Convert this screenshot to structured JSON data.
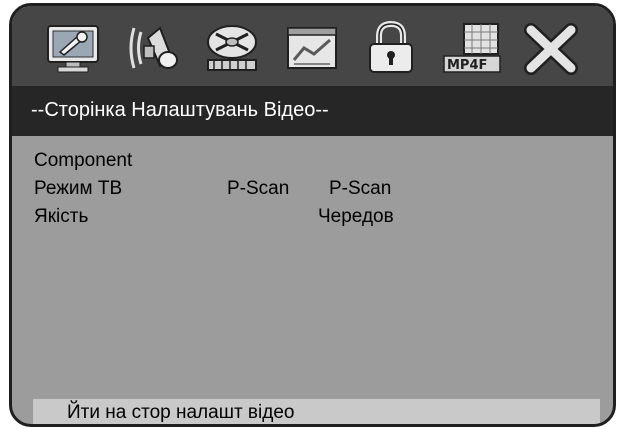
{
  "menu": {
    "icons": [
      {
        "name": "system-setup-icon",
        "label": "System Setup"
      },
      {
        "name": "audio-setup-icon",
        "label": "Audio Setup"
      },
      {
        "name": "video-setup-icon",
        "label": "Video Setup"
      },
      {
        "name": "preference-setup-icon",
        "label": "Preference Setup"
      },
      {
        "name": "password-setup-icon",
        "label": "Password Setup"
      },
      {
        "name": "mpeg4-setup-icon",
        "label": "MPEG4 Setup"
      },
      {
        "name": "exit-setup-icon",
        "label": "Exit Setup"
      }
    ],
    "active_icon": "video-setup-icon"
  },
  "page": {
    "title": "--Сторінка Налаштувань Відео--"
  },
  "settings": {
    "component_label": "Component",
    "tv_mode_label": "Режим ТВ",
    "tv_mode_value": "P-Scan",
    "tv_mode_option": "P-Scan",
    "quality_label": "Якість",
    "quality_value": "Чередов"
  },
  "footer": {
    "hint": "Йти на стор налашт відео"
  },
  "colors": {
    "panel": "#9c9c9c",
    "icon_bar": "#464646",
    "title_bar": "#262626",
    "hint_bar": "#c9c9c9",
    "border": "#1f1f1f"
  }
}
